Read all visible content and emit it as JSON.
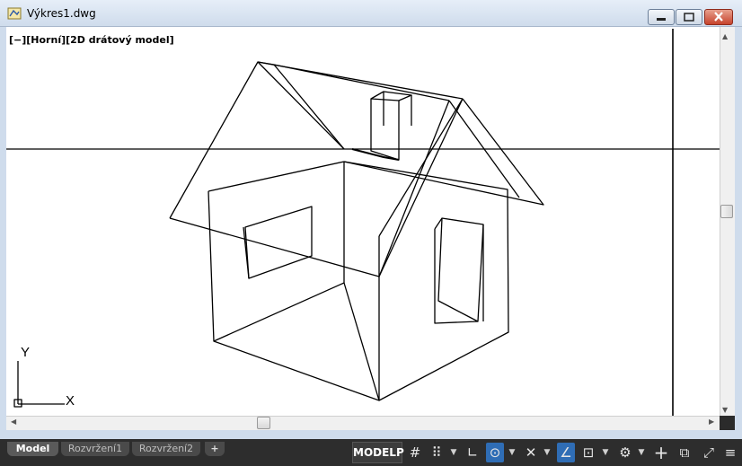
{
  "window": {
    "title": "Výkres1.dwg"
  },
  "viewport": {
    "label": "[−][Horní][2D drátový model]",
    "ucs_x_label": "X",
    "ucs_y_label": "Y"
  },
  "scrollbars": {
    "up": "▲",
    "down": "▼",
    "left": "◀",
    "right": "▶"
  },
  "tabs": [
    {
      "label": "Model",
      "active": true
    },
    {
      "label": "Rozvržení1",
      "active": false
    },
    {
      "label": "Rozvržení2",
      "active": false
    },
    {
      "label": "+",
      "active": false
    }
  ],
  "statusbar": {
    "modelp": "MODELP",
    "icons": [
      {
        "name": "grid-icon",
        "glyph": "#",
        "active": false
      },
      {
        "name": "snap-icon",
        "glyph": "⠿",
        "active": false
      },
      {
        "name": "ortho-icon",
        "glyph": "∟",
        "active": false
      },
      {
        "name": "polar-icon",
        "glyph": "⊙",
        "active": true
      },
      {
        "name": "isodraft-icon",
        "glyph": "✕",
        "active": false
      },
      {
        "name": "osnap-track-icon",
        "glyph": "∠",
        "active": true
      },
      {
        "name": "osnap-icon",
        "glyph": "⊡",
        "active": false
      },
      {
        "name": "settings-gear-icon",
        "glyph": "⚙",
        "active": false
      },
      {
        "name": "crosshair-icon",
        "glyph": "+",
        "active": false
      },
      {
        "name": "workspace-icon",
        "glyph": "⧉",
        "active": false
      },
      {
        "name": "fullscreen-icon",
        "glyph": "⤢",
        "active": false
      },
      {
        "name": "menu-icon",
        "glyph": "≡",
        "active": false
      }
    ]
  },
  "colors": {
    "accent": "#2f6db5",
    "canvas": "#ffffff",
    "linework": "#000000"
  }
}
